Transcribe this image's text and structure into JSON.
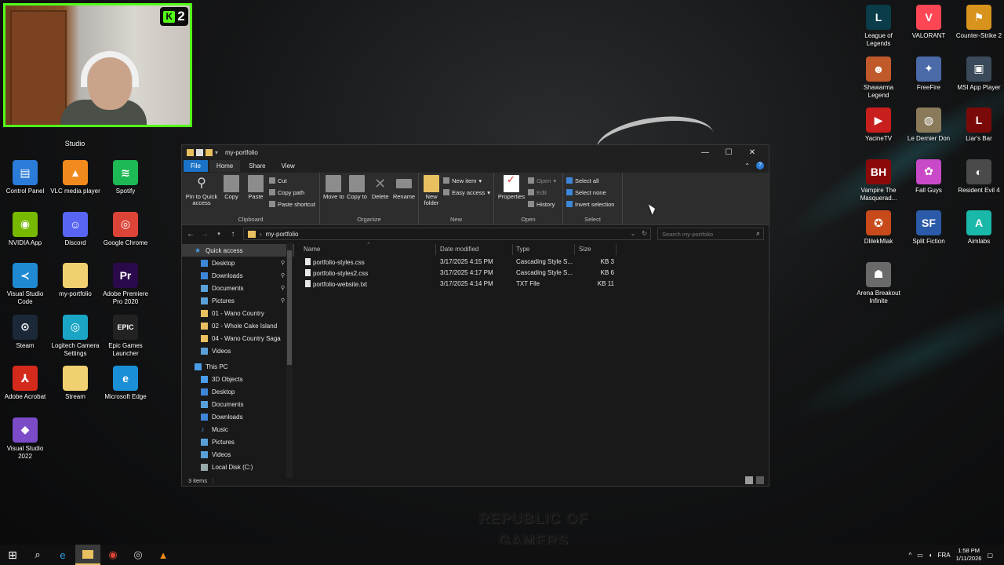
{
  "webcam": {
    "badge_count": "2",
    "badge_letter": "K",
    "label": "Studio"
  },
  "desktop_left": [
    {
      "label": "Control Panel",
      "icon": "control-panel-icon",
      "glyph": "▤",
      "color": "#2b7bd8"
    },
    {
      "label": "VLC media player",
      "icon": "vlc-icon",
      "glyph": "▲",
      "color": "#f08a1c"
    },
    {
      "label": "Spotify",
      "icon": "spotify-icon",
      "glyph": "≋",
      "color": "#1db954"
    },
    {
      "label": "NVIDIA App",
      "icon": "nvidia-icon",
      "glyph": "◉",
      "color": "#76b900"
    },
    {
      "label": "Discord",
      "icon": "discord-icon",
      "glyph": "☺",
      "color": "#5865f2"
    },
    {
      "label": "Google Chrome",
      "icon": "chrome-icon",
      "glyph": "◎",
      "color": "#db4437"
    },
    {
      "label": "Visual Studio Code",
      "icon": "vscode-icon",
      "glyph": "≺",
      "color": "#1f8ad2"
    },
    {
      "label": "my-portfolio",
      "icon": "folder-icon",
      "glyph": "",
      "color": "#f0d070"
    },
    {
      "label": "Adobe Premiere Pro 2020",
      "icon": "premiere-icon",
      "glyph": "Pr",
      "color": "#2a0a4a"
    },
    {
      "label": "Steam",
      "icon": "steam-icon",
      "glyph": "⊙",
      "color": "#1b2838"
    },
    {
      "label": "Logitech Camera Settings",
      "icon": "logitech-icon",
      "glyph": "◎",
      "color": "#1aa5c4"
    },
    {
      "label": "Epic Games Launcher",
      "icon": "epic-games-icon",
      "glyph": "EPIC",
      "color": "#222222"
    },
    {
      "label": "Adobe Acrobat",
      "icon": "acrobat-icon",
      "glyph": "⅄",
      "color": "#d42a1c"
    },
    {
      "label": "Stream",
      "icon": "folder-icon",
      "glyph": "",
      "color": "#f0d070"
    },
    {
      "label": "Microsoft Edge",
      "icon": "edge-icon",
      "glyph": "e",
      "color": "#1a8fd8"
    },
    {
      "label": "Visual Studio 2022",
      "icon": "visual-studio-icon",
      "glyph": "◆",
      "color": "#7b4bc8"
    }
  ],
  "desktop_right": [
    {
      "label": "League of Legends",
      "icon": "league-icon",
      "glyph": "L",
      "color": "#0a3c4a"
    },
    {
      "label": "VALORANT",
      "icon": "valorant-icon",
      "glyph": "V",
      "color": "#ff4655"
    },
    {
      "label": "Counter-Strike 2",
      "icon": "cs2-icon",
      "glyph": "⚑",
      "color": "#d8931c"
    },
    {
      "label": "Shawarma Legend",
      "icon": "shawarma-icon",
      "glyph": "☻",
      "color": "#c05a2a"
    },
    {
      "label": "FreeFire",
      "icon": "freefire-icon",
      "glyph": "✦",
      "color": "#4a6aa8"
    },
    {
      "label": "MSI App Player",
      "icon": "msi-icon",
      "glyph": "▣",
      "color": "#3a4a5a"
    },
    {
      "label": "YacineTV",
      "icon": "yacinetv-icon",
      "glyph": "▶",
      "color": "#c81e1e"
    },
    {
      "label": "Le Dernier Don",
      "icon": "dernier-don-icon",
      "glyph": "◍",
      "color": "#8a7a5a"
    },
    {
      "label": "Liar's Bar",
      "icon": "liars-bar-icon",
      "glyph": "L",
      "color": "#7a0a0a"
    },
    {
      "label": "Vampire The Masquerad...",
      "icon": "vampire-icon",
      "glyph": "BH",
      "color": "#8a0a0a"
    },
    {
      "label": "Fall Guys",
      "icon": "fall-guys-icon",
      "glyph": "✿",
      "color": "#c84ac8"
    },
    {
      "label": "Resident Evil 4",
      "icon": "re4-icon",
      "glyph": "◐",
      "color": "#4a4a4a"
    },
    {
      "label": "DlilekMlak",
      "icon": "dlilekmlak-icon",
      "glyph": "✪",
      "color": "#c84a1a"
    },
    {
      "label": "Split Fiction",
      "icon": "split-fiction-icon",
      "glyph": "SF",
      "color": "#2a5aa8"
    },
    {
      "label": "Aimlabs",
      "icon": "aimlabs-icon",
      "glyph": "A",
      "color": "#1ab8a8"
    },
    {
      "label": "Arena Breakout Infinite",
      "icon": "arena-breakout-icon",
      "glyph": "☗",
      "color": "#6a6a6a"
    }
  ],
  "explorer": {
    "title": "my-portfolio",
    "tabs": {
      "file": "File",
      "home": "Home",
      "share": "Share",
      "view": "View"
    },
    "clipboard": {
      "pin": "Pin to Quick access",
      "copy": "Copy",
      "paste": "Paste",
      "cut": "Cut",
      "copy_path": "Copy path",
      "paste_shortcut": "Paste shortcut",
      "label": "Clipboard"
    },
    "organize": {
      "move_to": "Move to",
      "copy_to": "Copy to",
      "delete": "Delete",
      "rename": "Rename",
      "label": "Organize"
    },
    "new": {
      "new_folder": "New folder",
      "new_item": "New item",
      "easy_access": "Easy access",
      "label": "New"
    },
    "open": {
      "properties": "Properties",
      "open": "Open",
      "edit": "Edit",
      "history": "History",
      "label": "Open"
    },
    "select": {
      "select_all": "Select all",
      "select_none": "Select none",
      "invert": "Invert selection",
      "label": "Select"
    },
    "address": "my-portfolio",
    "search_placeholder": "Search my-portfolio",
    "nav": {
      "quick_access": "Quick access",
      "qa_items": [
        {
          "label": "Desktop",
          "pinned": true,
          "kind": "blue"
        },
        {
          "label": "Downloads",
          "pinned": true,
          "kind": "blue"
        },
        {
          "label": "Documents",
          "pinned": true,
          "kind": "img"
        },
        {
          "label": "Pictures",
          "pinned": true,
          "kind": "img"
        },
        {
          "label": "01 - Wano Country",
          "pinned": false,
          "kind": "folder"
        },
        {
          "label": "02 - Whole Cake Island",
          "pinned": false,
          "kind": "folder"
        },
        {
          "label": "04 - Wano Country Saga",
          "pinned": false,
          "kind": "folder"
        },
        {
          "label": "Videos",
          "pinned": false,
          "kind": "img"
        }
      ],
      "this_pc": "This PC",
      "pc_items": [
        {
          "label": "3D Objects",
          "kind": "pc"
        },
        {
          "label": "Desktop",
          "kind": "blue"
        },
        {
          "label": "Documents",
          "kind": "img"
        },
        {
          "label": "Downloads",
          "kind": "blue"
        },
        {
          "label": "Music",
          "kind": "music"
        },
        {
          "label": "Pictures",
          "kind": "img"
        },
        {
          "label": "Videos",
          "kind": "img"
        },
        {
          "label": "Local Disk (C:)",
          "kind": "disk"
        }
      ]
    },
    "columns": {
      "name": "Name",
      "date": "Date modified",
      "type": "Type",
      "size": "Size"
    },
    "files": [
      {
        "name": "portfolio-styles.css",
        "date": "3/17/2025 4:15 PM",
        "type": "Cascading Style S...",
        "size": "3 KB"
      },
      {
        "name": "portfolio-styles2.css",
        "date": "3/17/2025 4:17 PM",
        "type": "Cascading Style S...",
        "size": "6 KB"
      },
      {
        "name": "portfolio-website.txt",
        "date": "3/17/2025 4:14 PM",
        "type": "TXT File",
        "size": "11 KB"
      }
    ],
    "status": "3 items"
  },
  "wallpaper_text": {
    "line1": "REPUBLIC OF",
    "line2": "GAMERS"
  },
  "taskbar": {
    "language": "FRA",
    "time": "1:58 PM",
    "date": "1/11/2026",
    "tray_arrow": "^"
  }
}
